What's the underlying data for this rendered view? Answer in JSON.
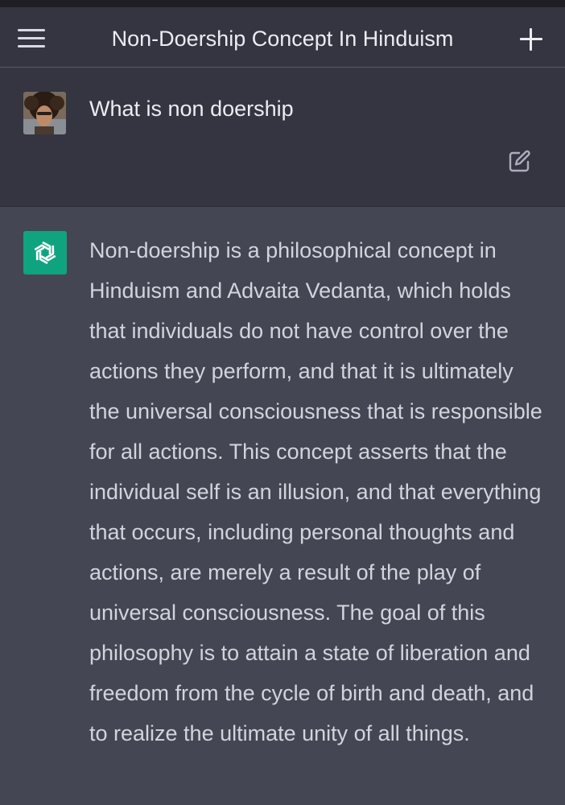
{
  "header": {
    "title": "Non-Doership Concept In Hinduism",
    "menu_icon": "hamburger-menu-icon",
    "new_chat_icon": "plus-icon"
  },
  "conversation": {
    "user_message": {
      "text": "What is non doership",
      "edit_icon": "edit-icon"
    },
    "assistant_message": {
      "text": "Non-doership is a philosophical concept in Hinduism and Advaita Vedanta, which holds that individuals do not have control over the actions they perform, and that it is ultimately the universal consciousness that is responsible for all actions. This concept asserts that the individual self is an illusion, and that everything that occurs, including personal thoughts and actions, are merely a result of the play of universal consciousness. The goal of this philosophy is to attain a state of liberation and freedom from the cycle of birth and death, and to realize the ultimate unity of all things."
    }
  },
  "colors": {
    "header_bg": "#343541",
    "user_bg": "#343541",
    "assistant_bg": "#444654",
    "brand_green": "#10a37f",
    "text_primary": "#ececf1",
    "text_answer": "#d1d5db"
  }
}
